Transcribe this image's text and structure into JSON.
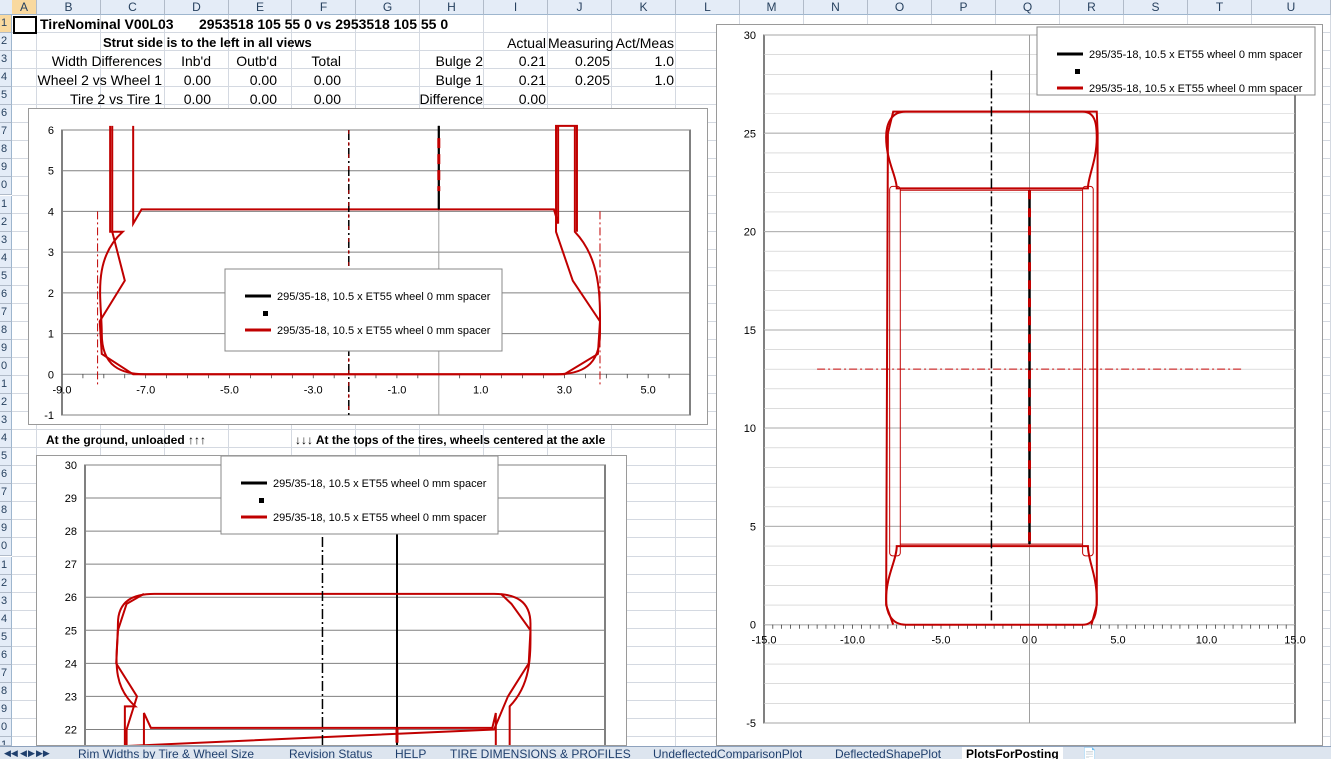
{
  "columns": [
    "A",
    "B",
    "C",
    "D",
    "E",
    "F",
    "G",
    "H",
    "I",
    "J",
    "K",
    "L",
    "M",
    "N",
    "O",
    "P",
    "Q",
    "R",
    "S",
    "T",
    "U"
  ],
  "selected_column": "A",
  "rows": [
    "1",
    "2",
    "3",
    "4",
    "5",
    "6",
    "7",
    "8",
    "9",
    "0",
    "1",
    "2",
    "3",
    "4",
    "5",
    "6",
    "7",
    "8",
    "9",
    "0",
    "1",
    "2",
    "3",
    "4",
    "5",
    "6",
    "7",
    "8",
    "9",
    "0",
    "1",
    "2",
    "3",
    "4",
    "5",
    "6",
    "7",
    "8",
    "9",
    "0",
    "1"
  ],
  "header": {
    "title": "TireNominal V00L03",
    "comparison": "2953518 105 55 0 vs  2953518 105 55 0",
    "strut_note": "Strut side is to the left in all views",
    "col_actual": "Actual",
    "col_measuring": "Measuring",
    "col_actmeas": "Act/Meas"
  },
  "width_table": {
    "heading": "Width Differences",
    "col_inbd": "Inb'd",
    "col_outbd": "Outb'd",
    "col_total": "Total",
    "rows": [
      {
        "label": "Wheel 2 vs Wheel 1",
        "inbd": "0.00",
        "outbd": "0.00",
        "total": "0.00"
      },
      {
        "label": "Tire 2 vs Tire 1",
        "inbd": "0.00",
        "outbd": "0.00",
        "total": "0.00"
      }
    ]
  },
  "bulge_table": {
    "rows": [
      {
        "label": "Bulge 2",
        "actual": "0.21",
        "measuring": "0.205",
        "actmeas": "1.0"
      },
      {
        "label": "Bulge 1",
        "actual": "0.21",
        "measuring": "0.205",
        "actmeas": "1.0"
      },
      {
        "label": "Difference",
        "actual": "0.00",
        "measuring": "",
        "actmeas": ""
      }
    ]
  },
  "captions": {
    "left": "At the ground, unloaded ↑↑↑",
    "right": "↓↓↓ At the tops of the tires, wheels centered at the axle"
  },
  "legend": {
    "series1": "295/35-18, 10.5 x ET55 wheel 0 mm spacer",
    "series2": "295/35-18, 10.5 x ET55 wheel 0 mm spacer"
  },
  "colors": {
    "series1": "#000000",
    "series2": "#c00000",
    "grid": "#808080",
    "header_bg": "#e4ecf7",
    "selected_header": "#f9d99f"
  },
  "chart_data": [
    {
      "id": "ground-profile",
      "type": "line",
      "title": "",
      "xlim": [
        -9,
        6
      ],
      "ylim": [
        -1,
        6
      ],
      "x_ticks": [
        "-9.0",
        "-7.0",
        "-5.0",
        "-3.0",
        "-1.0",
        "1.0",
        "3.0",
        "5.0"
      ],
      "y_ticks": [
        "-1",
        "0",
        "1",
        "2",
        "3",
        "4",
        "5",
        "6"
      ],
      "series": [
        {
          "name": "295/35-18, 10.5 x ET55 wheel 0 mm spacer",
          "color": "#000000",
          "x": [
            0,
            0
          ],
          "y": [
            4.05,
            6.1
          ]
        },
        {
          "name": "295/35-18, 10.5 x ET55 wheel 0 mm spacer",
          "color": "#c00000",
          "x": [
            -7.8,
            -7.8,
            -7.5,
            -8.1,
            -8.05,
            -7.3,
            3.0,
            3.8,
            3.85,
            3.2,
            2.8,
            2.8,
            3.3,
            3.3
          ],
          "y": [
            6.1,
            3.5,
            2.3,
            1.3,
            0.5,
            0.0,
            0.0,
            0.5,
            1.3,
            2.3,
            3.5,
            6.1,
            6.1,
            3.5
          ]
        }
      ]
    },
    {
      "id": "top-profile",
      "type": "line",
      "title": "",
      "xlim": [
        -9,
        6
      ],
      "ylim": [
        21.5,
        30
      ],
      "y_ticks": [
        "22",
        "23",
        "24",
        "25",
        "26",
        "27",
        "28",
        "29",
        "30"
      ],
      "series": [
        {
          "name": "295/35-18, 10.5 x ET55 wheel 0 mm spacer",
          "color": "#000000",
          "x": [
            0,
            0
          ],
          "y": [
            21.5,
            30
          ]
        },
        {
          "name": "295/35-18, 10.5 x ET55 wheel 0 mm spacer",
          "color": "#c00000",
          "x": [
            -7.3,
            -7.8,
            -8.05,
            -8.1,
            -7.5,
            -7.8,
            -7.8,
            2.8,
            3.2,
            3.8,
            3.85,
            3.3,
            3.0
          ],
          "y": [
            26.1,
            25.8,
            25.0,
            24.0,
            23.0,
            22.0,
            21.5,
            22.0,
            23.0,
            24.0,
            25.0,
            25.8,
            26.1
          ]
        }
      ]
    },
    {
      "id": "side-view",
      "type": "line",
      "title": "",
      "xlim": [
        -15,
        15
      ],
      "ylim": [
        -5,
        30
      ],
      "x_ticks": [
        "-15.0",
        "-10.0",
        "-5.0",
        "0.0",
        "5.0",
        "10.0",
        "15.0"
      ],
      "y_ticks": [
        "-5",
        "0",
        "5",
        "10",
        "15",
        "20",
        "25",
        "30"
      ],
      "series": [
        {
          "name": "295/35-18, 10.5 x ET55 wheel 0 mm spacer",
          "color": "#000000",
          "x": [
            0,
            0
          ],
          "y": [
            4.1,
            22.1
          ]
        },
        {
          "name": "295/35-18, 10.5 x ET55 wheel 0 mm spacer",
          "color": "#c00000",
          "x": [
            -7.7,
            -8.1,
            -8.0,
            -7.7,
            3.8,
            3.85,
            3.8,
            3.5
          ],
          "y": [
            0.0,
            1.0,
            25.0,
            26.1,
            26.1,
            25.0,
            1.0,
            0.0
          ]
        }
      ]
    }
  ]
}
